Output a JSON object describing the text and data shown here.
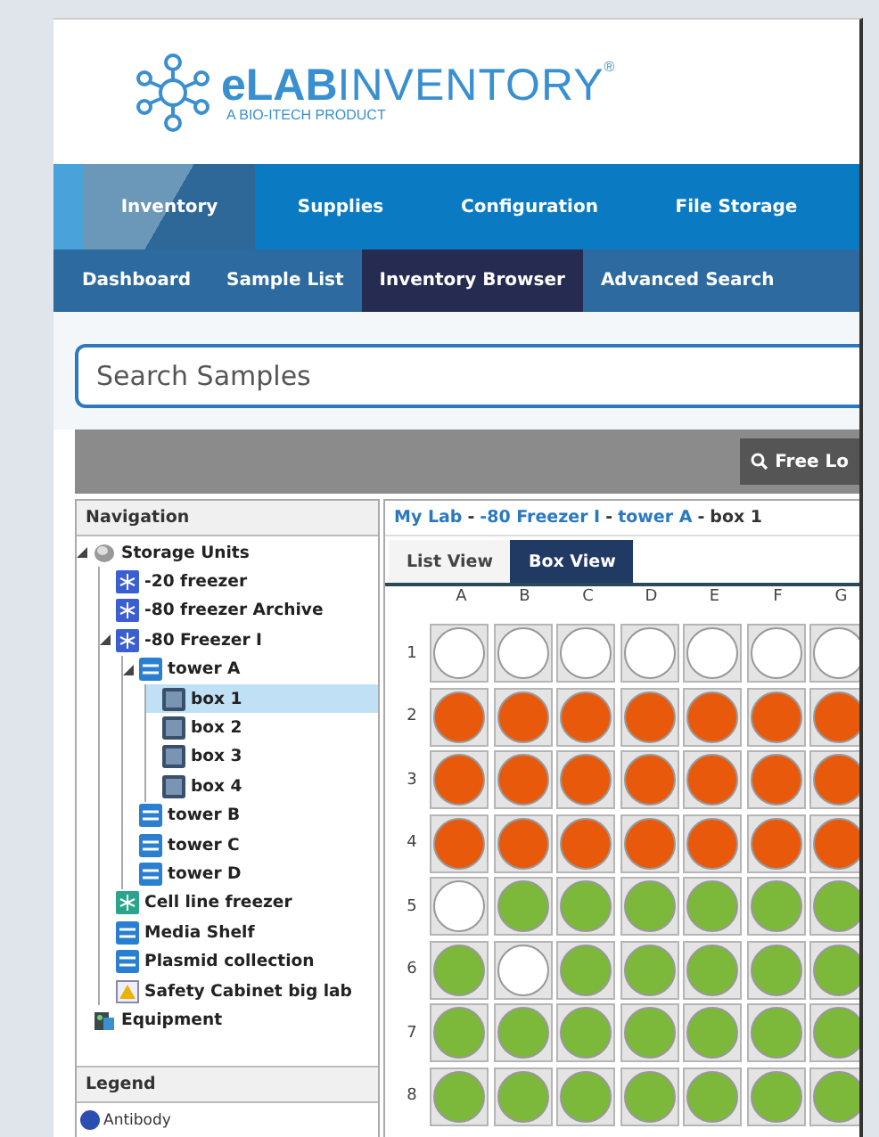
{
  "logo": {
    "bold": "eLAB",
    "light": "INVENTORY",
    "mark": "®",
    "tagline": "A BIO-ITECH PRODUCT"
  },
  "main_nav": [
    {
      "label": "Inventory",
      "selected": true
    },
    {
      "label": "Supplies",
      "selected": false
    },
    {
      "label": "Configuration",
      "selected": false
    },
    {
      "label": "File Storage",
      "selected": false
    }
  ],
  "sub_nav": [
    {
      "label": "Dashboard",
      "selected": false
    },
    {
      "label": "Sample List",
      "selected": false
    },
    {
      "label": "Inventory Browser",
      "selected": true
    },
    {
      "label": "Advanced Search",
      "selected": false
    }
  ],
  "search": {
    "placeholder": "Search Samples"
  },
  "toolbar": {
    "button": "Free Lo"
  },
  "navigation": {
    "title": "Navigation",
    "tree": [
      {
        "label": "Storage Units",
        "kind": "root",
        "expanded": true,
        "selected": false,
        "children": [
          {
            "label": "-20 freezer",
            "kind": "freezer",
            "expanded": false,
            "selected": false
          },
          {
            "label": "-80 freezer Archive",
            "kind": "freezer",
            "expanded": false,
            "selected": false
          },
          {
            "label": "-80 Freezer I",
            "kind": "freezer",
            "expanded": true,
            "selected": false,
            "children": [
              {
                "label": "tower A",
                "kind": "tower",
                "expanded": true,
                "selected": false,
                "children": [
                  {
                    "label": "box 1",
                    "kind": "box",
                    "expanded": false,
                    "selected": true
                  },
                  {
                    "label": "box 2",
                    "kind": "box",
                    "expanded": false,
                    "selected": false
                  },
                  {
                    "label": "box 3",
                    "kind": "box",
                    "expanded": false,
                    "selected": false
                  },
                  {
                    "label": "box 4",
                    "kind": "box",
                    "expanded": false,
                    "selected": false
                  }
                ]
              },
              {
                "label": "tower B",
                "kind": "tower",
                "expanded": false,
                "selected": false
              },
              {
                "label": "tower C",
                "kind": "tower",
                "expanded": false,
                "selected": false
              },
              {
                "label": "tower D",
                "kind": "tower",
                "expanded": false,
                "selected": false
              }
            ]
          },
          {
            "label": "Cell line freezer",
            "kind": "cell-freezer",
            "expanded": false,
            "selected": false
          },
          {
            "label": "Media Shelf",
            "kind": "tower",
            "expanded": false,
            "selected": false
          },
          {
            "label": "Plasmid collection",
            "kind": "tower",
            "expanded": false,
            "selected": false
          },
          {
            "label": "Safety Cabinet big lab",
            "kind": "cabinet",
            "expanded": false,
            "selected": false
          }
        ]
      },
      {
        "label": "Equipment",
        "kind": "equipment",
        "expanded": false,
        "selected": false
      }
    ]
  },
  "legend": {
    "title": "Legend",
    "items": [
      {
        "label": "Antibody",
        "color": "#2a4fb0"
      }
    ]
  },
  "breadcrumb": {
    "links": [
      "My Lab",
      "-80 Freezer I",
      "tower A"
    ],
    "separator": "-",
    "current": "box 1"
  },
  "view_tabs": [
    {
      "label": "List View",
      "selected": false
    },
    {
      "label": "Box View",
      "selected": true
    }
  ],
  "box": {
    "columns": [
      "A",
      "B",
      "C",
      "D",
      "E",
      "F",
      "G"
    ],
    "rows": [
      {
        "label": "1",
        "wells": [
          {
            "color": "#ffffff"
          },
          {
            "color": "#ffffff"
          },
          {
            "color": "#ffffff"
          },
          {
            "color": "#ffffff"
          },
          {
            "color": "#ffffff"
          },
          {
            "color": "#ffffff"
          },
          {
            "color": "#ffffff"
          }
        ]
      },
      {
        "label": "2",
        "wells": [
          {
            "color": "#e8590c"
          },
          {
            "color": "#e8590c"
          },
          {
            "color": "#e8590c"
          },
          {
            "color": "#e8590c"
          },
          {
            "color": "#e8590c"
          },
          {
            "color": "#e8590c"
          },
          {
            "color": "#e8590c"
          }
        ]
      },
      {
        "label": "3",
        "wells": [
          {
            "color": "#e8590c"
          },
          {
            "color": "#e8590c"
          },
          {
            "color": "#e8590c"
          },
          {
            "color": "#e8590c"
          },
          {
            "color": "#e8590c"
          },
          {
            "color": "#e8590c"
          },
          {
            "color": "#e8590c"
          }
        ]
      },
      {
        "label": "4",
        "wells": [
          {
            "color": "#e8590c"
          },
          {
            "color": "#e8590c"
          },
          {
            "color": "#e8590c"
          },
          {
            "color": "#e8590c"
          },
          {
            "color": "#e8590c"
          },
          {
            "color": "#e8590c"
          },
          {
            "color": "#e8590c"
          }
        ]
      },
      {
        "label": "5",
        "wells": [
          {
            "color": "#ffffff"
          },
          {
            "color": "#7cb83a"
          },
          {
            "color": "#7cb83a"
          },
          {
            "color": "#7cb83a"
          },
          {
            "color": "#7cb83a"
          },
          {
            "color": "#7cb83a"
          },
          {
            "color": "#7cb83a"
          }
        ]
      },
      {
        "label": "6",
        "wells": [
          {
            "color": "#7cb83a"
          },
          {
            "color": "#ffffff"
          },
          {
            "color": "#7cb83a"
          },
          {
            "color": "#7cb83a"
          },
          {
            "color": "#7cb83a"
          },
          {
            "color": "#7cb83a"
          },
          {
            "color": "#7cb83a"
          }
        ]
      },
      {
        "label": "7",
        "wells": [
          {
            "color": "#7cb83a"
          },
          {
            "color": "#7cb83a"
          },
          {
            "color": "#7cb83a"
          },
          {
            "color": "#7cb83a"
          },
          {
            "color": "#7cb83a"
          },
          {
            "color": "#7cb83a"
          },
          {
            "color": "#7cb83a"
          }
        ]
      },
      {
        "label": "8",
        "wells": [
          {
            "color": "#7cb83a"
          },
          {
            "color": "#7cb83a"
          },
          {
            "color": "#7cb83a"
          },
          {
            "color": "#7cb83a"
          },
          {
            "color": "#7cb83a"
          },
          {
            "color": "#7cb83a"
          },
          {
            "color": "#7cb83a"
          }
        ]
      }
    ]
  }
}
